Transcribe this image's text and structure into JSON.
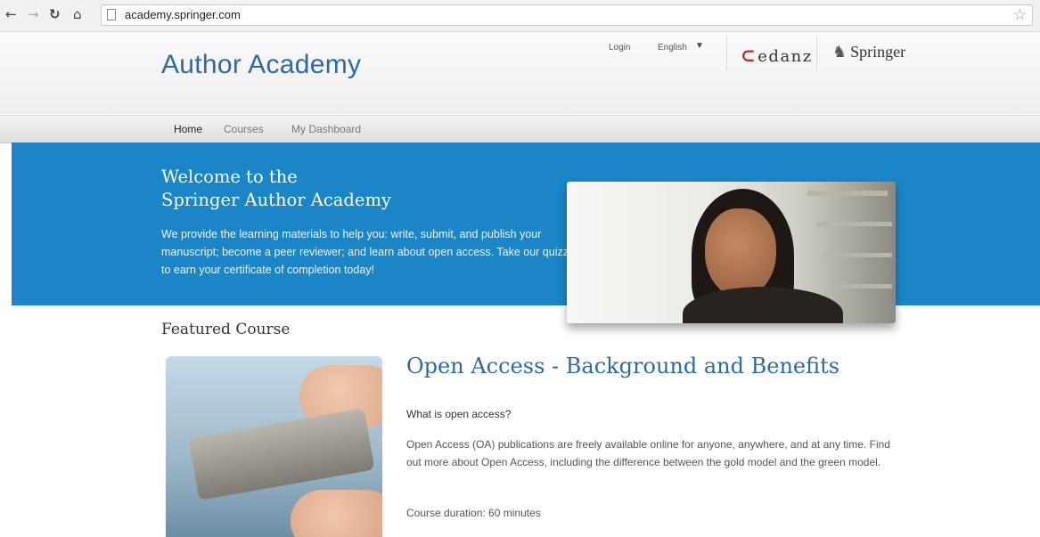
{
  "browser": {
    "nav_buttons": [
      "back-icon",
      "forward-icon",
      "reload-icon",
      "home-icon"
    ],
    "url": "academy.springer.com"
  },
  "header": {
    "brand": "Author Academy",
    "login": "Login",
    "language": "English",
    "partner_logo": "edanz",
    "publisher_logo": "Springer"
  },
  "nav": {
    "items": [
      "Home",
      "Courses",
      "My Dashboard"
    ],
    "active": "Home"
  },
  "hero": {
    "title_line1": "Welcome to the",
    "title_line2": "Springer Author Academy",
    "text": "We provide the learning materials to help you: write, submit, and publish your manuscript; become a peer reviewer; and learn about open access. Take our quizzes to earn your certificate of completion today!"
  },
  "featured": {
    "heading": "Featured Course",
    "course_title": "Open Access - Background and Benefits",
    "question": "What is open access?",
    "description": "Open Access (OA) publications are freely available online for anyone, anywhere, and at any time. Find out more about Open Access, including the difference between the gold model and the green model.",
    "duration": "Course duration: 60 minutes"
  },
  "colors": {
    "hero_bg": "#1a86c8",
    "brand_blue": "#2b6aa7",
    "edanz_red": "#c0202a"
  }
}
